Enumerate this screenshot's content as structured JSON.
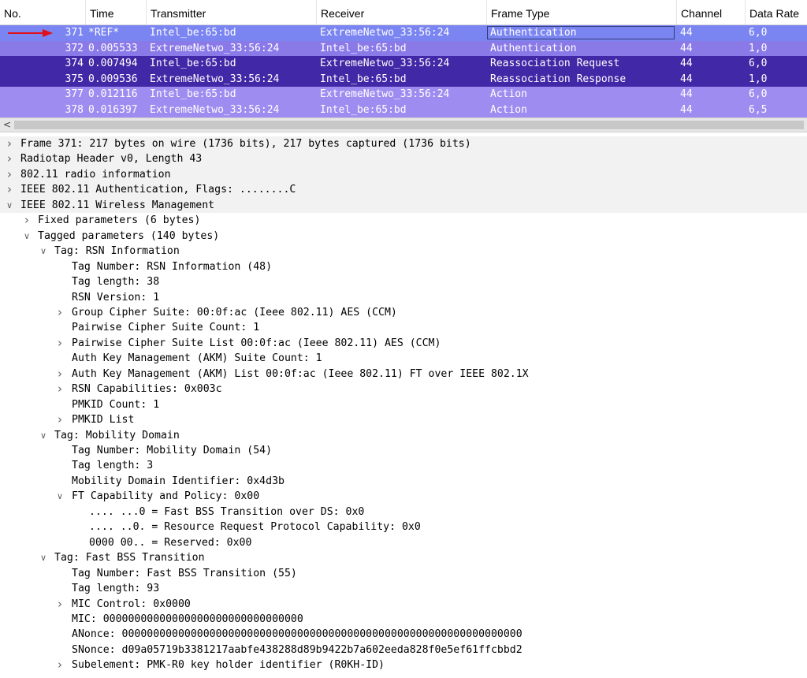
{
  "packet_list": {
    "columns": [
      "No.",
      "Time",
      "Transmitter",
      "Receiver",
      "Frame Type",
      "Channel",
      "Data Rate"
    ],
    "rows": [
      {
        "no": "371",
        "time": "*REF*",
        "transmitter": "Intel_be:65:bd",
        "receiver": "ExtremeNetwo_33:56:24",
        "frame_type": "Authentication",
        "channel": "44",
        "rate": "6,0",
        "bg": "#7b85f2",
        "marked": true
      },
      {
        "no": "372",
        "time": "0.005533",
        "transmitter": "ExtremeNetwo_33:56:24",
        "receiver": "Intel_be:65:bd",
        "frame_type": "Authentication",
        "channel": "44",
        "rate": "1,0",
        "bg": "#8a7ae8",
        "marked": false
      },
      {
        "no": "374",
        "time": "0.007494",
        "transmitter": "Intel_be:65:bd",
        "receiver": "ExtremeNetwo_33:56:24",
        "frame_type": "Reassociation Request",
        "channel": "44",
        "rate": "6,0",
        "bg": "#4128a6",
        "marked": false
      },
      {
        "no": "375",
        "time": "0.009536",
        "transmitter": "ExtremeNetwo_33:56:24",
        "receiver": "Intel_be:65:bd",
        "frame_type": "Reassociation Response",
        "channel": "44",
        "rate": "1,0",
        "bg": "#4128a6",
        "marked": false
      },
      {
        "no": "377",
        "time": "0.012116",
        "transmitter": "Intel_be:65:bd",
        "receiver": "ExtremeNetwo_33:56:24",
        "frame_type": "Action",
        "channel": "44",
        "rate": "6,0",
        "bg": "#9f8cf0",
        "marked": false
      },
      {
        "no": "378",
        "time": "0.016397",
        "transmitter": "ExtremeNetwo_33:56:24",
        "receiver": "Intel_be:65:bd",
        "frame_type": "Action",
        "channel": "44",
        "rate": "6,5",
        "bg": "#9f8cf0",
        "marked": false
      }
    ]
  },
  "scrollbar": {
    "left_glyph": "<"
  },
  "detail_tree": [
    {
      "level": 0,
      "toggle": "collapsed",
      "text": "Frame 371: 217 bytes on wire (1736 bits), 217 bytes captured (1736 bits)"
    },
    {
      "level": 0,
      "toggle": "collapsed",
      "text": "Radiotap Header v0, Length 43"
    },
    {
      "level": 0,
      "toggle": "collapsed",
      "text": "802.11 radio information"
    },
    {
      "level": 0,
      "toggle": "collapsed",
      "text": "IEEE 802.11 Authentication, Flags: ........C"
    },
    {
      "level": 0,
      "toggle": "expanded",
      "text": "IEEE 802.11 Wireless Management"
    },
    {
      "level": 1,
      "toggle": "collapsed",
      "text": "Fixed parameters (6 bytes)"
    },
    {
      "level": 1,
      "toggle": "expanded",
      "text": "Tagged parameters (140 bytes)"
    },
    {
      "level": 2,
      "toggle": "expanded",
      "text": "Tag: RSN Information"
    },
    {
      "level": 3,
      "toggle": "none",
      "text": "Tag Number: RSN Information (48)"
    },
    {
      "level": 3,
      "toggle": "none",
      "text": "Tag length: 38"
    },
    {
      "level": 3,
      "toggle": "none",
      "text": "RSN Version: 1"
    },
    {
      "level": 3,
      "toggle": "collapsed",
      "text": "Group Cipher Suite: 00:0f:ac (Ieee 802.11) AES (CCM)"
    },
    {
      "level": 3,
      "toggle": "none",
      "text": "Pairwise Cipher Suite Count: 1"
    },
    {
      "level": 3,
      "toggle": "collapsed",
      "text": "Pairwise Cipher Suite List 00:0f:ac (Ieee 802.11) AES (CCM)"
    },
    {
      "level": 3,
      "toggle": "none",
      "text": "Auth Key Management (AKM) Suite Count: 1"
    },
    {
      "level": 3,
      "toggle": "collapsed",
      "text": "Auth Key Management (AKM) List 00:0f:ac (Ieee 802.11) FT over IEEE 802.1X"
    },
    {
      "level": 3,
      "toggle": "collapsed",
      "text": "RSN Capabilities: 0x003c"
    },
    {
      "level": 3,
      "toggle": "none",
      "text": "PMKID Count: 1"
    },
    {
      "level": 3,
      "toggle": "collapsed",
      "text": "PMKID List"
    },
    {
      "level": 2,
      "toggle": "expanded",
      "text": "Tag: Mobility Domain"
    },
    {
      "level": 3,
      "toggle": "none",
      "text": "Tag Number: Mobility Domain (54)"
    },
    {
      "level": 3,
      "toggle": "none",
      "text": "Tag length: 3"
    },
    {
      "level": 3,
      "toggle": "none",
      "text": "Mobility Domain Identifier: 0x4d3b"
    },
    {
      "level": 3,
      "toggle": "expanded",
      "text": "FT Capability and Policy: 0x00"
    },
    {
      "level": 4,
      "toggle": "none",
      "text": ".... ...0 = Fast BSS Transition over DS: 0x0"
    },
    {
      "level": 4,
      "toggle": "none",
      "text": ".... ..0. = Resource Request Protocol Capability: 0x0"
    },
    {
      "level": 4,
      "toggle": "none",
      "text": "0000 00.. = Reserved: 0x00"
    },
    {
      "level": 2,
      "toggle": "expanded",
      "text": "Tag: Fast BSS Transition"
    },
    {
      "level": 3,
      "toggle": "none",
      "text": "Tag Number: Fast BSS Transition (55)"
    },
    {
      "level": 3,
      "toggle": "none",
      "text": "Tag length: 93"
    },
    {
      "level": 3,
      "toggle": "collapsed",
      "text": "MIC Control: 0x0000"
    },
    {
      "level": 3,
      "toggle": "none",
      "text": "MIC: 00000000000000000000000000000000"
    },
    {
      "level": 3,
      "toggle": "none",
      "text": "ANonce: 0000000000000000000000000000000000000000000000000000000000000000"
    },
    {
      "level": 3,
      "toggle": "none",
      "text": "SNonce: d09a05719b3381217aabfe438288d89b9422b7a602eeda828f0e5ef61ffcbbd2"
    },
    {
      "level": 3,
      "toggle": "collapsed",
      "text": "Subelement: PMK-R0 key holder identifier (R0KH-ID)"
    }
  ]
}
